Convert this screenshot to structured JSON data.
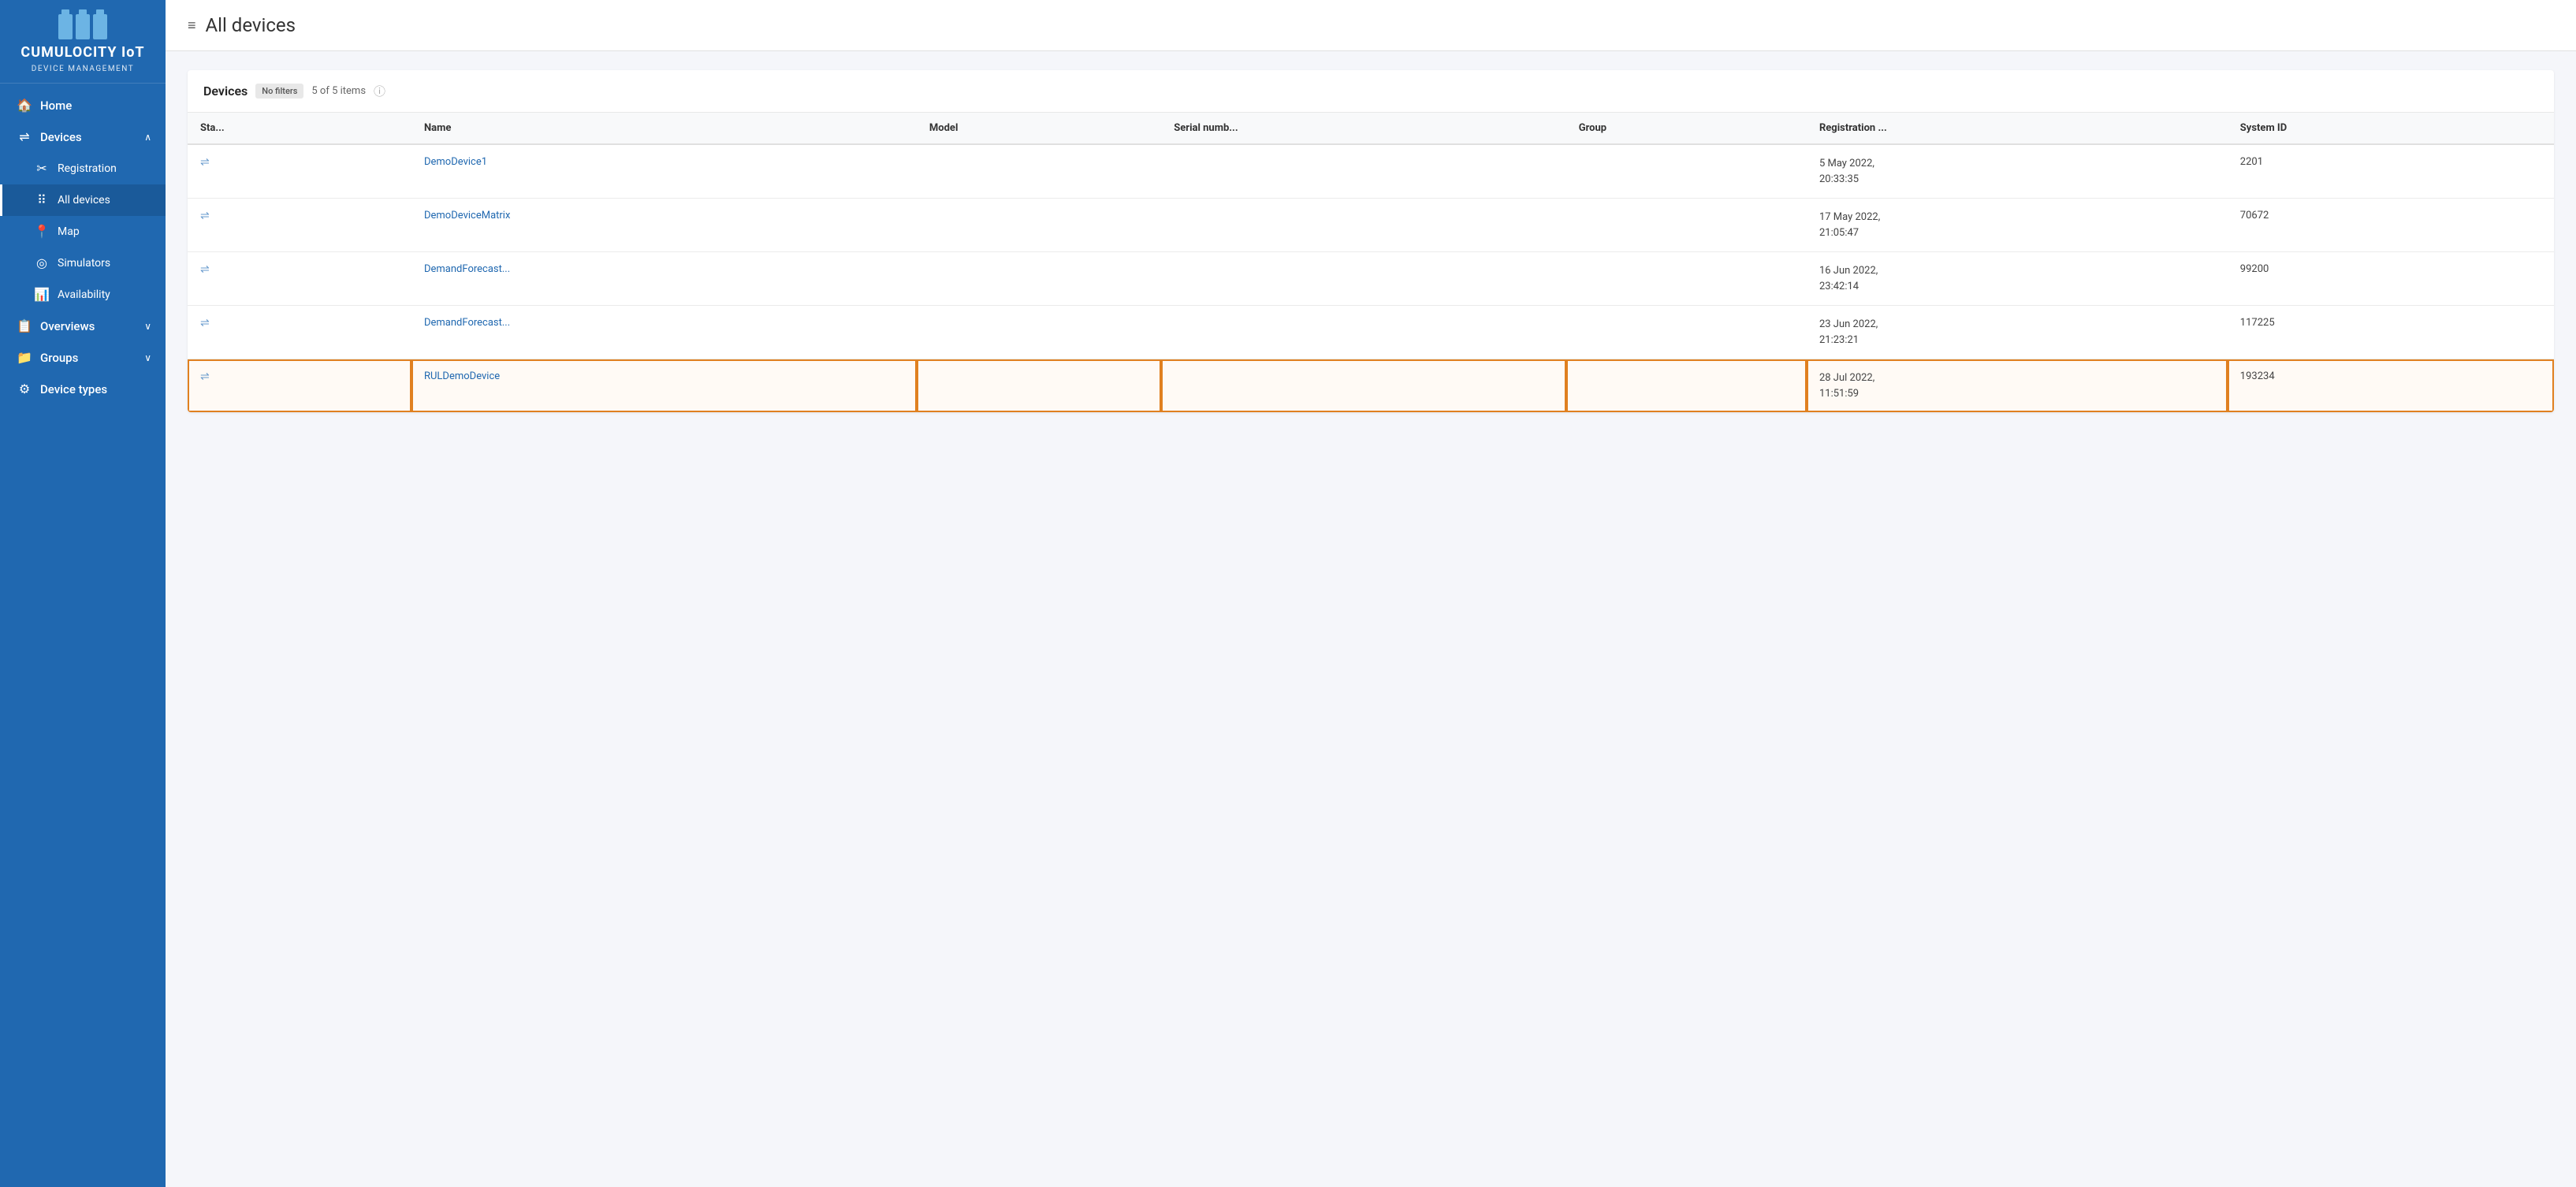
{
  "brand": {
    "title": "CUMULOCITY IoT",
    "subtitle": "DEVICE MANAGEMENT"
  },
  "sidebar": {
    "items": [
      {
        "id": "home",
        "label": "Home",
        "icon": "🏠",
        "level": "parent"
      },
      {
        "id": "devices",
        "label": "Devices",
        "icon": "⇌",
        "level": "parent",
        "chevron": "∧",
        "expanded": true
      },
      {
        "id": "registration",
        "label": "Registration",
        "icon": "✂",
        "level": "child"
      },
      {
        "id": "all-devices",
        "label": "All devices",
        "icon": "⠿",
        "level": "child",
        "active": true
      },
      {
        "id": "map",
        "label": "Map",
        "icon": "📍",
        "level": "child"
      },
      {
        "id": "simulators",
        "label": "Simulators",
        "icon": "◎",
        "level": "child"
      },
      {
        "id": "availability",
        "label": "Availability",
        "icon": "📊",
        "level": "child"
      },
      {
        "id": "overviews",
        "label": "Overviews",
        "icon": "📋",
        "level": "parent",
        "chevron": "∨"
      },
      {
        "id": "groups",
        "label": "Groups",
        "icon": "📁",
        "level": "parent",
        "chevron": "∨"
      },
      {
        "id": "device-types",
        "label": "Device types",
        "icon": "⚙",
        "level": "parent"
      }
    ]
  },
  "page": {
    "icon": "≡",
    "title": "All devices"
  },
  "devices_section": {
    "label": "Devices",
    "badge": "No filters",
    "count": "5 of 5 items"
  },
  "table": {
    "columns": [
      "Sta...",
      "Name",
      "Model",
      "Serial numb...",
      "Group",
      "Registration ...",
      "System ID"
    ],
    "rows": [
      {
        "status": "⇌",
        "name": "DemoDevice1",
        "model": "",
        "serial": "",
        "group": "",
        "registration": "5 May 2022,\n20:33:35",
        "systemId": "2201",
        "selected": false
      },
      {
        "status": "⇌",
        "name": "DemoDeviceMatrix",
        "model": "",
        "serial": "",
        "group": "",
        "registration": "17 May 2022,\n21:05:47",
        "systemId": "70672",
        "selected": false
      },
      {
        "status": "⇌",
        "name": "DemandForecast...",
        "model": "",
        "serial": "",
        "group": "",
        "registration": "16 Jun 2022,\n23:42:14",
        "systemId": "99200",
        "selected": false
      },
      {
        "status": "⇌",
        "name": "DemandForecast...",
        "model": "",
        "serial": "",
        "group": "",
        "registration": "23 Jun 2022,\n21:23:21",
        "systemId": "117225",
        "selected": false
      },
      {
        "status": "⇌",
        "name": "RULDemoDevice",
        "model": "",
        "serial": "",
        "group": "",
        "registration": "28 Jul 2022,\n11:51:59",
        "systemId": "193234",
        "selected": true
      }
    ]
  },
  "colors": {
    "sidebar_bg": "#2068b0",
    "sidebar_active": "#1a5a9a",
    "link": "#2068b0",
    "selected_border": "#e08020"
  }
}
